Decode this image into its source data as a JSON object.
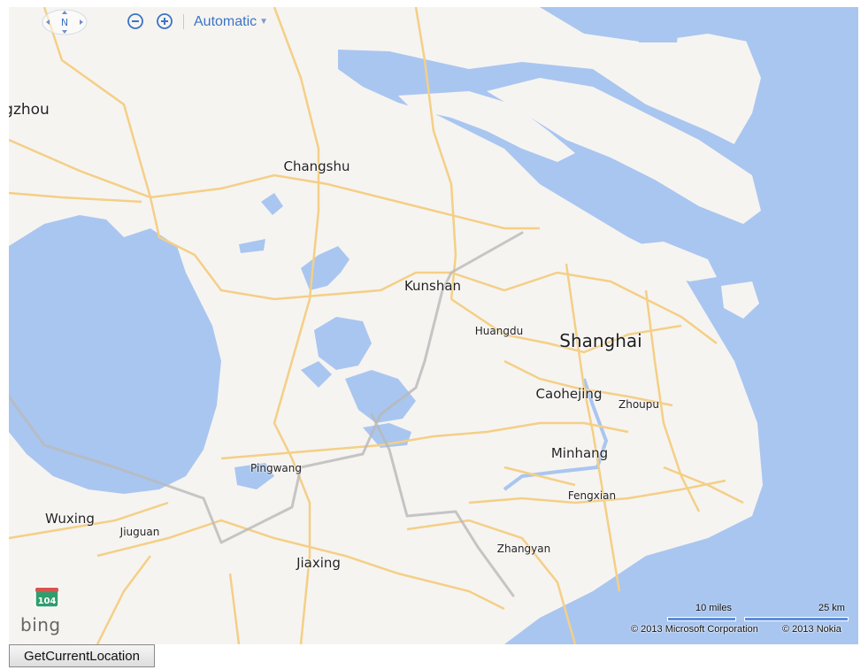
{
  "toolbar": {
    "compass_label": "N",
    "map_type_label": "Automatic"
  },
  "places": {
    "shanghai": "Shanghai",
    "kunshan": "Kunshan",
    "changshu": "Changshu",
    "huangdu": "Huangdu",
    "caohejing": "Caohejing",
    "zhoupu": "Zhoupu",
    "minhang": "Minhang",
    "fengxian": "Fengxian",
    "zhangyan": "Zhangyan",
    "pingwang": "Pingwang",
    "wuxing": "Wuxing",
    "jiuguan": "Jiuguan",
    "jiaxing": "Jiaxing",
    "suzhou_partial": "gzhou"
  },
  "road_shield": "104",
  "brand": "bing",
  "scale": {
    "miles": "10 miles",
    "km": "25 km"
  },
  "copyright": {
    "microsoft": "© 2013 Microsoft Corporation",
    "nokia": "© 2013 Nokia"
  },
  "colors": {
    "water": "#a9c6f0",
    "land": "#f6f4f1",
    "road": "#f4cf86",
    "border": "#b9b9b9"
  },
  "button": {
    "label": "GetCurrentLocation"
  }
}
